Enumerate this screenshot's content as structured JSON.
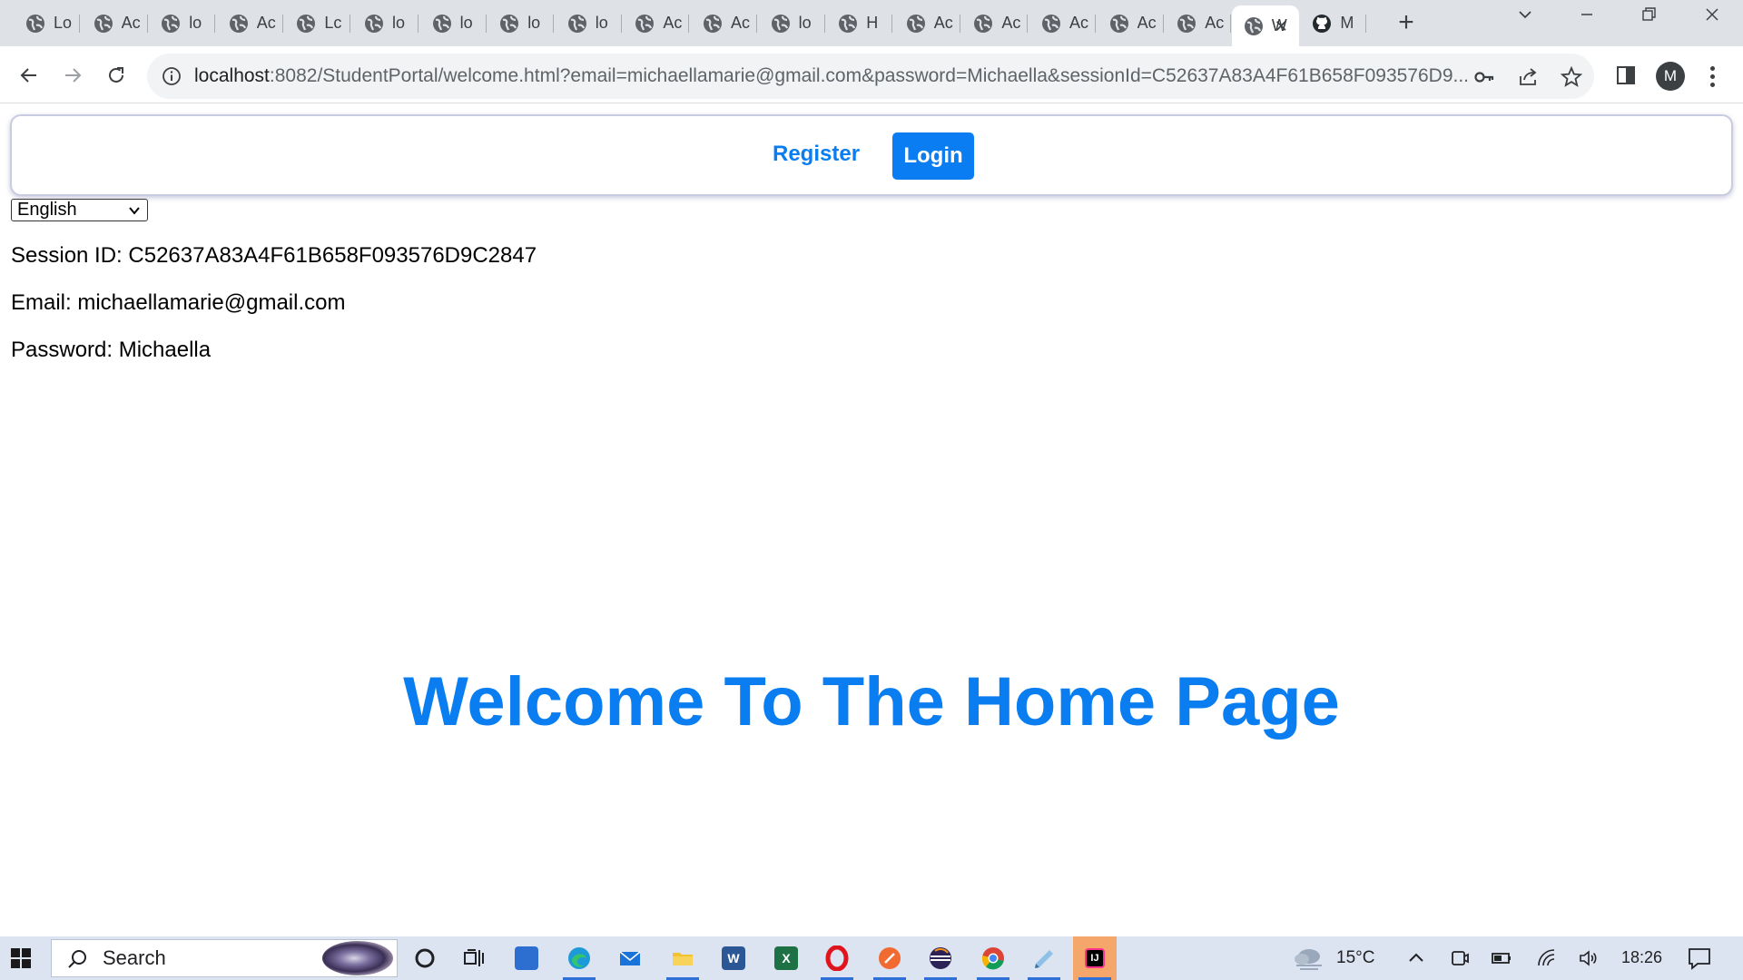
{
  "browser": {
    "tabs": [
      {
        "title": "Lo",
        "active": false
      },
      {
        "title": "Ac",
        "active": false
      },
      {
        "title": "lo",
        "active": false
      },
      {
        "title": "Ac",
        "active": false
      },
      {
        "title": "Lc",
        "active": false
      },
      {
        "title": "lo",
        "active": false
      },
      {
        "title": "lo",
        "active": false
      },
      {
        "title": "lo",
        "active": false
      },
      {
        "title": "lo",
        "active": false
      },
      {
        "title": "Ac",
        "active": false
      },
      {
        "title": "Ac",
        "active": false
      },
      {
        "title": "lo",
        "active": false
      },
      {
        "title": "H",
        "active": false
      },
      {
        "title": "Ac",
        "active": false
      },
      {
        "title": "Ac",
        "active": false
      },
      {
        "title": "Ac",
        "active": false
      },
      {
        "title": "Ac",
        "active": false
      },
      {
        "title": "Ac",
        "active": false
      },
      {
        "title": "W",
        "active": true
      },
      {
        "title": "M",
        "active": false,
        "icon": "github-icon"
      }
    ],
    "new_tab_symbol": "+",
    "url_host": "localhost",
    "url_rest": ":8082/StudentPortal/welcome.html?email=michaellamarie@gmail.com&password=Michaella&sessionId=C52637A83A4F61B658F093576D9...",
    "profile_initial": "M"
  },
  "page": {
    "nav": {
      "register_label": "Register",
      "login_label": "Login"
    },
    "language_select": {
      "selected": "English"
    },
    "session_line": "Session ID: C52637A83A4F61B658F093576D9C2847",
    "email_line": "Email: michaellamarie@gmail.com",
    "password_line": "Password: Michaella",
    "welcome_heading": "Welcome To The Home Page"
  },
  "taskbar": {
    "search_placeholder": "Search",
    "weather_temp": "15°C",
    "clock": "18:26",
    "apps": [
      "task-view-icon",
      "widgets-icon",
      "store-icon",
      "edge-icon",
      "mail-icon",
      "file-explorer-icon",
      "word-icon",
      "excel-icon",
      "opera-icon",
      "postman-icon",
      "eclipse-icon",
      "chrome-icon",
      "notepad-icon",
      "intellij-icon"
    ]
  },
  "colors": {
    "accent_blue": "#0a7ef0",
    "tabstrip_bg": "#dee1e6",
    "taskbar_bg": "#dce4f1"
  }
}
